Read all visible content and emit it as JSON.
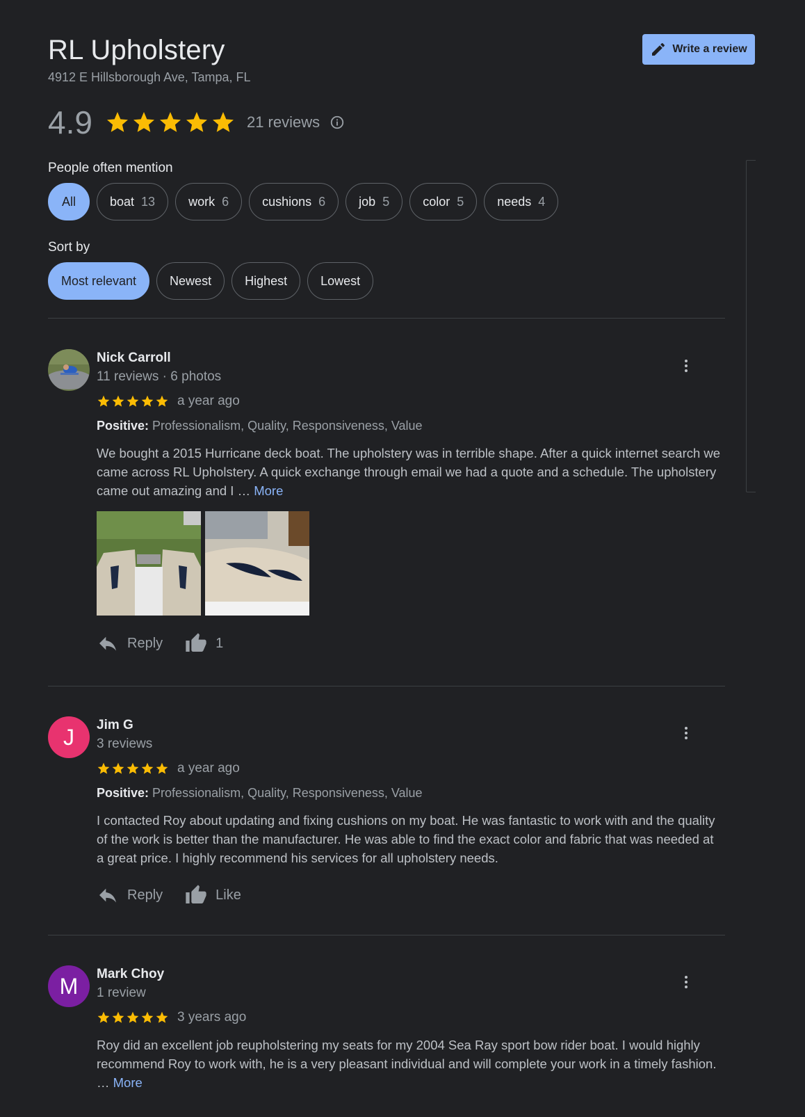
{
  "business": {
    "name": "RL Upholstery",
    "address": "4912 E Hillsborough Ave, Tampa, FL",
    "rating": "4.9",
    "rating_value": 4.9,
    "review_count": "21 reviews",
    "write_review_label": "Write a review"
  },
  "colors": {
    "background": "#202124",
    "accent": "#8ab4f8",
    "star": "#fbbc04"
  },
  "mentions": {
    "label": "People often mention",
    "chips": [
      {
        "label": "All",
        "count": ""
      },
      {
        "label": "boat",
        "count": "13"
      },
      {
        "label": "work",
        "count": "6"
      },
      {
        "label": "cushions",
        "count": "6"
      },
      {
        "label": "job",
        "count": "5"
      },
      {
        "label": "color",
        "count": "5"
      },
      {
        "label": "needs",
        "count": "4"
      }
    ]
  },
  "sort": {
    "label": "Sort by",
    "options": [
      "Most relevant",
      "Newest",
      "Highest",
      "Lowest"
    ],
    "selected": "Most relevant"
  },
  "reviews": [
    {
      "name": "Nick Carroll",
      "meta": "11 reviews · 6 photos",
      "stars": 5,
      "when": "a year ago",
      "positive_label": "Positive:",
      "positive": "Professionalism, Quality, Responsiveness, Value",
      "text": "We bought a 2015 Hurricane deck boat. The upholstery was in terrible shape. After a quick internet search we came across RL Upholstery. A quick exchange through email we had a quote and a schedule. The upholstery came out amazing and I … ",
      "more": "More",
      "reply": "Reply",
      "like": "1"
    },
    {
      "name": "Jim G",
      "initial": "J",
      "avatar_color": "#e8336f",
      "meta": "3 reviews",
      "stars": 5,
      "when": "a year ago",
      "positive_label": "Positive:",
      "positive": "Professionalism, Quality, Responsiveness, Value",
      "text": "I contacted Roy about updating and fixing cushions on my boat.  He was fantastic to work with and the quality of the work is better than the manufacturer. He was able to find the exact color and fabric that was needed at a great price.  I highly recommend his services for all upholstery needs.",
      "reply": "Reply",
      "like": "Like"
    },
    {
      "name": "Mark Choy",
      "initial": "M",
      "avatar_color": "#7b1fa2",
      "meta": "1 review",
      "stars": 5,
      "when": "3 years ago",
      "text": "Roy did an excellent job reupholstering my seats for my 2004 Sea Ray sport bow rider boat. I would highly recommend Roy to work with, he is a very pleasant individual and will complete your work in a timely fashion. … ",
      "more": "More"
    }
  ]
}
